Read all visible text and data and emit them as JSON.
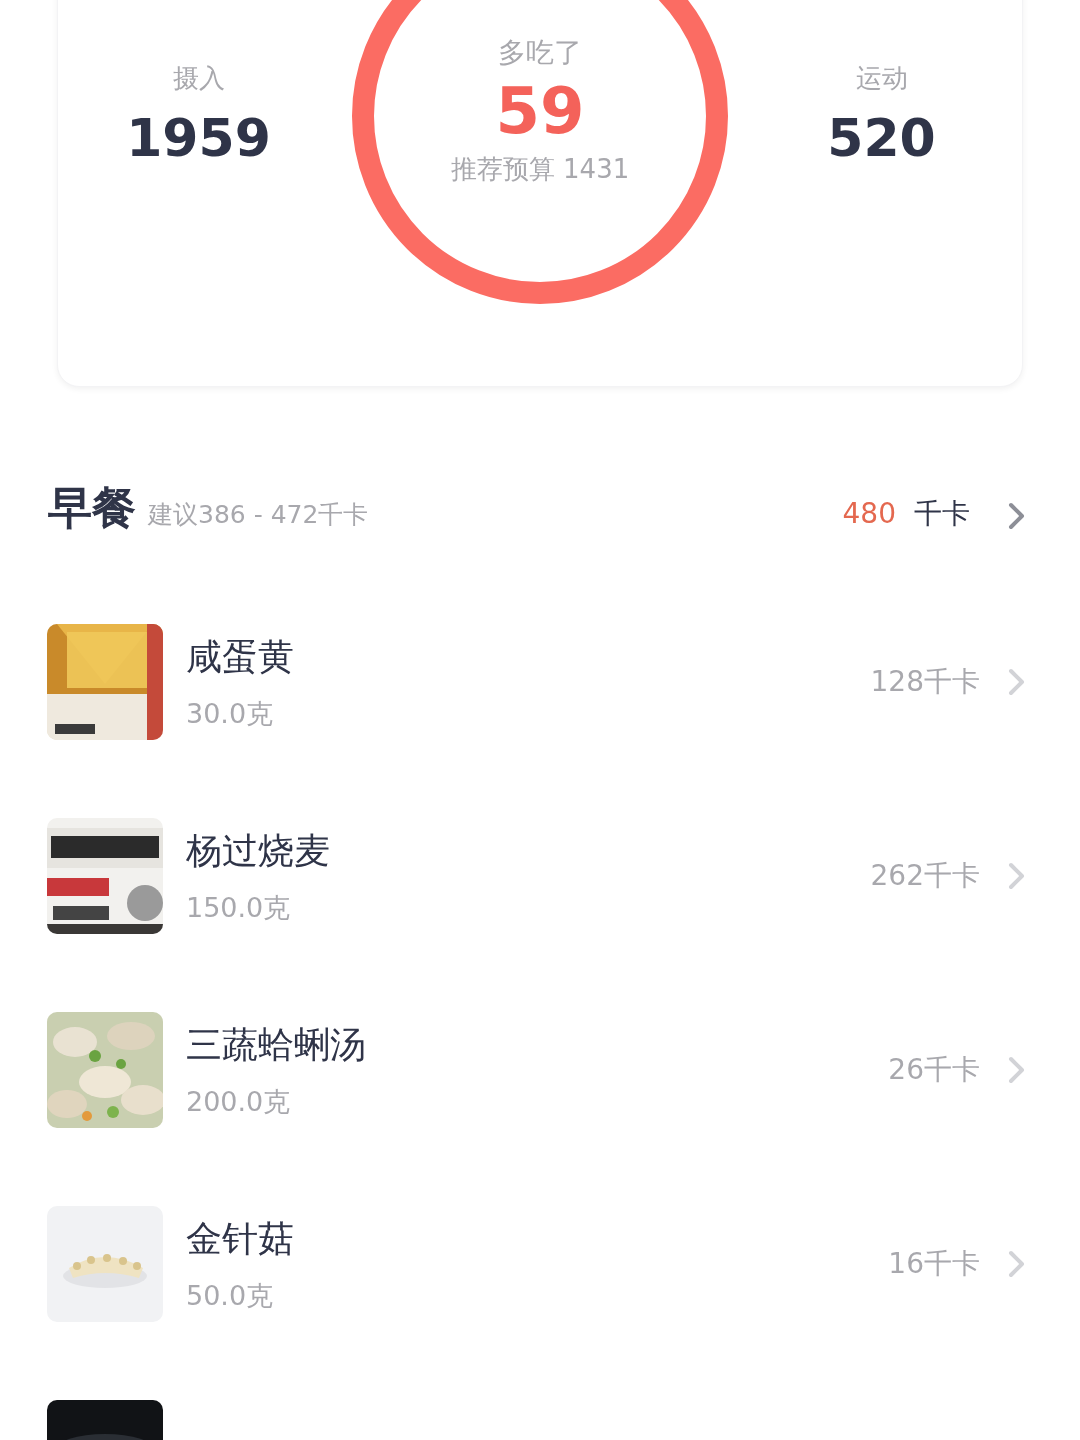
{
  "summary": {
    "intake": {
      "label": "摄入",
      "value": "1959"
    },
    "center": {
      "label": "多吃了",
      "value": "59",
      "budget": "推荐预算 1431"
    },
    "exercise": {
      "label": "运动",
      "value": "520"
    }
  },
  "meal": {
    "title": "早餐",
    "suggestion": "建议386 - 472千卡",
    "total": "480",
    "unit": "千卡"
  },
  "foods": [
    {
      "name": "咸蛋黄",
      "amount": "30.0克",
      "calories": "128千卡",
      "kind": "picture"
    },
    {
      "name": "杨过烧麦",
      "amount": "150.0克",
      "calories": "262千卡",
      "kind": "picture"
    },
    {
      "name": "三蔬蛤蜊汤",
      "amount": "200.0克",
      "calories": "26千卡",
      "kind": "picture"
    },
    {
      "name": "金针菇",
      "amount": "50.0克",
      "calories": "16千卡",
      "kind": "picture"
    }
  ]
}
